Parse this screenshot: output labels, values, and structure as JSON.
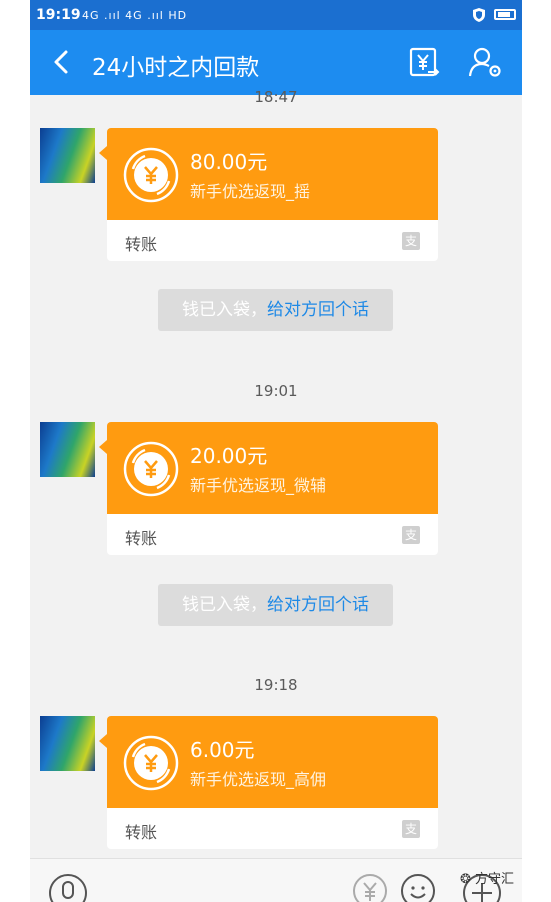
{
  "status_bar": {
    "time": "19:19",
    "signal": "4G .ııl 4G .ııl HD"
  },
  "nav": {
    "title": "24小时之内回款"
  },
  "timestamps": [
    "18:47",
    "19:01",
    "19:18"
  ],
  "transfers": [
    {
      "amount": "80.00元",
      "desc": "新手优选返现_摇",
      "label": "转账"
    },
    {
      "amount": "20.00元",
      "desc": "新手优选返现_微辅",
      "label": "转账"
    },
    {
      "amount": "6.00元",
      "desc": "新手优选返现_高佣",
      "label": "转账"
    }
  ],
  "notices": [
    {
      "text": "钱已入袋，",
      "link": "给对方回个话"
    },
    {
      "text": "钱已入袋，",
      "link": "给对方回个话"
    }
  ],
  "icons": {
    "back": "back-arrow-icon",
    "transfer": "yuan-transfer-icon",
    "profile": "user-settings-icon",
    "coin": "yuan-coin-icon",
    "pay_logo": "alipay-logo-icon",
    "voice": "microphone-icon",
    "money": "yuan-icon",
    "emoji": "smiley-icon",
    "more": "plus-icon"
  },
  "colors": {
    "nav": "#1d8cf0",
    "status": "#1b6fd0",
    "card": "#ff9b10",
    "link": "#1e89e6"
  },
  "watermark": "方守汇"
}
